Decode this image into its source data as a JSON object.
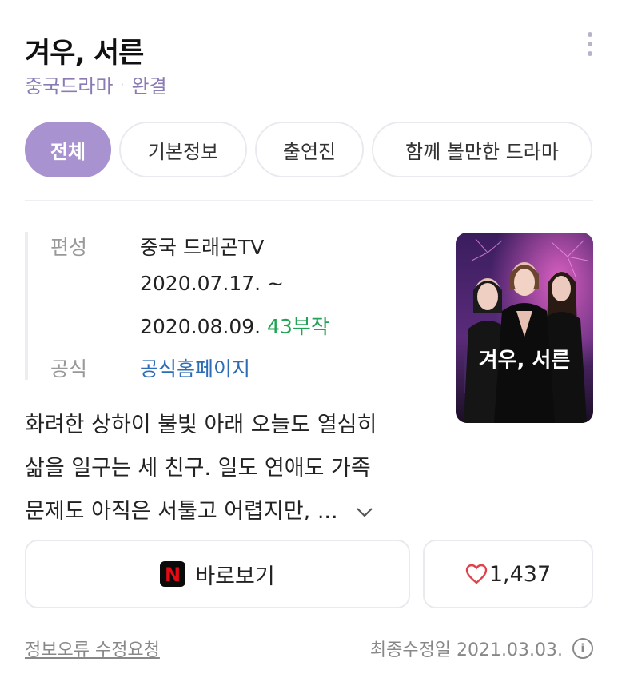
{
  "header": {
    "title": "겨우, 서른",
    "genre": "중국드라마",
    "separator": "·",
    "status": "완결"
  },
  "tabs": [
    {
      "label": "전체",
      "active": true
    },
    {
      "label": "기본정보",
      "active": false
    },
    {
      "label": "출연진",
      "active": false
    },
    {
      "label": "함께 볼만한 드라마",
      "active": false
    }
  ],
  "info": {
    "broadcast_label": "편성",
    "broadcast_value": "중국 드래곤TV",
    "dates_line1": "2020.07.17. ~",
    "dates_line2": "2020.08.09.",
    "episodes": "43부작",
    "official_label": "공식",
    "official_link": "공식홈페이지"
  },
  "poster": {
    "title_text": "겨우, 서른"
  },
  "description": {
    "line1": "화려한 상하이 불빛 아래 오늘도 열심히",
    "line2": "삶을 일구는 세 친구. 일도 연애도 가족",
    "line3": "문제도 아직은 서툴고 어렵지만, ...",
    "expand_icon": "chevron-down-icon"
  },
  "actions": {
    "watch_label": "바로보기",
    "watch_icon": "netflix-logo",
    "netflix_letter": "N",
    "like_count": "1,437",
    "like_icon": "heart-icon"
  },
  "footer": {
    "report_label": "정보오류 수정요청",
    "updated_text": "최종수정일 2021.03.03.",
    "info_icon": "i"
  },
  "colors": {
    "accent": "#a892cf",
    "subtitle": "#8b7bb5",
    "episodes_green": "#21a356",
    "link_blue": "#2c6db5",
    "heart_red": "#e0424a",
    "netflix_red": "#e50914"
  }
}
